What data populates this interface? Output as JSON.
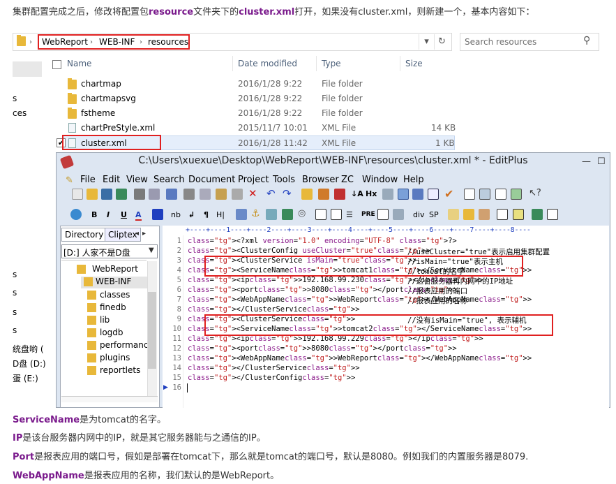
{
  "intro": {
    "part1": "集群配置完成之后，修改将配置包",
    "kw1": "resource",
    "part2": "文件夹下的",
    "kw2": "cluster.xml",
    "part3": "打开，如果没有cluster.xml，则新建一个，基本内容如下："
  },
  "explorer": {
    "breadcrumb": [
      "WebReport",
      "WEB-INF",
      "resources"
    ],
    "search_placeholder": "Search resources",
    "columns": {
      "name": "Name",
      "date": "Date modified",
      "type": "Type",
      "size": "Size"
    },
    "files": [
      {
        "name": "chartmap",
        "date": "2016/1/28 9:22",
        "type": "File folder",
        "size": "",
        "kind": "folder"
      },
      {
        "name": "chartmapsvg",
        "date": "2016/1/28 9:22",
        "type": "File folder",
        "size": "",
        "kind": "folder"
      },
      {
        "name": "fstheme",
        "date": "2016/1/28 9:22",
        "type": "File folder",
        "size": "",
        "kind": "folder"
      },
      {
        "name": "chartPreStyle.xml",
        "date": "2015/11/7 10:01",
        "type": "XML File",
        "size": "14 KB",
        "kind": "xml"
      },
      {
        "name": "cluster.xml",
        "date": "2016/1/28 11:42",
        "type": "XML File",
        "size": "1 KB",
        "kind": "xml",
        "selected": true
      }
    ],
    "left_fragments": [
      "s",
      "ces",
      "s",
      "s",
      "s",
      "s"
    ],
    "left_drives": [
      "统盘哟 (",
      "D盘 (D:)",
      "蛋 (E:)"
    ]
  },
  "editplus": {
    "title": "C:\\Users\\xuexue\\Desktop\\WebReport\\WEB-INF\\resources\\cluster.xml * - EditPlus",
    "menu": [
      "File",
      "Edit",
      "View",
      "Search",
      "Document",
      "Project",
      "Tools",
      "Browser",
      "ZC",
      "Window",
      "Help"
    ],
    "tabs": [
      "Directory",
      "Cliptex"
    ],
    "drive": "[D:] 人家不是D盘",
    "tree": [
      "WebReport",
      "WEB-INF",
      "classes",
      "finedb",
      "lib",
      "logdb",
      "performance",
      "plugins",
      "reportlets"
    ],
    "ruler": "+----+----1----+----2----+----3----+----4----+----5----+----6----+----7----+----8----",
    "code_lines": [
      {
        "n": "1",
        "text": "<?xml version=\"1.0\" encoding=\"UTF-8\" ?>"
      },
      {
        "n": "2",
        "text": "<ClusterConfig useCluster=\"true\">",
        "comment": "//useCluster=\"true\"表示启用集群配置"
      },
      {
        "n": "3",
        "text": "    <ClusterService  isMain=\"true\">",
        "comment": "//isMain=\"true\"表示主机"
      },
      {
        "n": "4",
        "text": "        <ServiceName>tomcat1</ServiceName>",
        "comment": "//tomcat的名字"
      },
      {
        "n": "5",
        "text": "        <ip>192.168.99.230</ip>",
        "comment": "//这台服务器再内网中的IP地址"
      },
      {
        "n": "6",
        "text": "        <port>8080</port>",
        "comment": "//报表应用的端口"
      },
      {
        "n": "7",
        "text": "        <WebAppName>WebReport</WebAppName>",
        "comment": "//报表应用的名称"
      },
      {
        "n": "8",
        "text": "    </ClusterService>"
      },
      {
        "n": "9",
        "text": "    <ClusterService>",
        "comment": "//没有isMain=\"true\", 表示辅机"
      },
      {
        "n": "10",
        "text": "        <ServiceName>tomcat2</ServiceName>"
      },
      {
        "n": "11",
        "text": "        <ip>192.168.99.229</ip>"
      },
      {
        "n": "12",
        "text": "        <port>8080</port>"
      },
      {
        "n": "13",
        "text": "        <WebAppName>WebReport</WebAppName>"
      },
      {
        "n": "14",
        "text": "    </ClusterService>"
      },
      {
        "n": "15",
        "text": "</ClusterConfig>"
      },
      {
        "n": "16",
        "text": ""
      }
    ]
  },
  "footer": [
    {
      "term": "ServiceName",
      "desc": "是为tomcat的名字。"
    },
    {
      "term": "IP",
      "desc": "是该台服务器内网中的IP，就是其它服务器能与之通信的IP。"
    },
    {
      "term": "Port",
      "desc": "是报表应用的端口号，假如是部署在tomcat下，那么就是tomcat的端口号，默认是8080。例如我们的内置服务器是8079."
    },
    {
      "term": "WebAppName",
      "desc": "是报表应用的名称，我们默认的是WebReport。"
    }
  ],
  "colors": {
    "highlight_term": "#7a1a8c",
    "red_box": "#e02020",
    "tag": "#1010c8",
    "attr": "#8a1a8a",
    "value": "#c01f1f"
  }
}
